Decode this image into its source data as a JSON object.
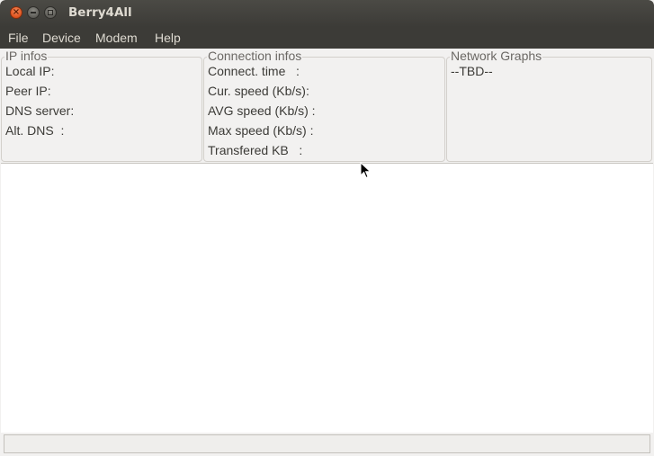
{
  "window": {
    "title": "Berry4All"
  },
  "menu": {
    "items": [
      "File",
      "Device",
      "Modem",
      "Help"
    ]
  },
  "ip_infos": {
    "title": "IP infos",
    "local_ip": "Local IP:",
    "peer_ip": "Peer IP:",
    "dns_server": "DNS server:",
    "alt_dns": "Alt. DNS  :"
  },
  "connection_infos": {
    "title": "Connection infos",
    "connect_time": "Connect. time   :",
    "cur_speed": "Cur. speed (Kb/s):",
    "avg_speed": "AVG speed (Kb/s) :",
    "max_speed": "Max speed (Kb/s) :",
    "transfered": "Transfered KB   :"
  },
  "network_graphs": {
    "title": "Network Graphs",
    "placeholder": "--TBD--"
  },
  "icons": {
    "close": "close-icon",
    "minimize": "minimize-icon",
    "maximize": "maximize-icon",
    "cursor": "mouse-pointer-icon"
  }
}
